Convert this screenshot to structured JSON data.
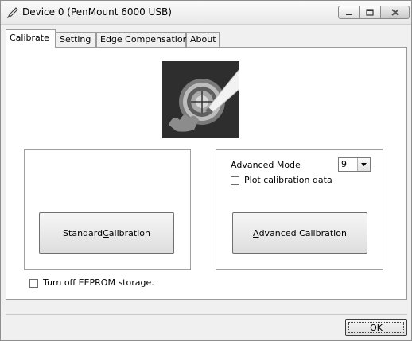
{
  "window": {
    "title": "Device 0 (PenMount 6000 USB)",
    "icon": "pen-icon"
  },
  "tabs": [
    {
      "label": "Calibrate",
      "active": true
    },
    {
      "label": "Setting",
      "active": false
    },
    {
      "label": "Edge Compensation",
      "active": false
    },
    {
      "label": "About",
      "active": false
    }
  ],
  "calibrate": {
    "logo": "calibration-target-logo",
    "standard_button": {
      "prefix": "Standard ",
      "hotkey": "C",
      "suffix": "alibration"
    },
    "advanced_mode": {
      "label": "Advanced Mode",
      "value": "9"
    },
    "plot_checkbox": {
      "hotkey": "P",
      "suffix": "lot calibration data",
      "checked": false
    },
    "advanced_button": {
      "hotkey": "A",
      "suffix": "dvanced Calibration"
    },
    "eeprom_checkbox": {
      "label": "Turn off EEPROM storage.",
      "checked": false
    }
  },
  "footer": {
    "ok_label": "OK"
  }
}
